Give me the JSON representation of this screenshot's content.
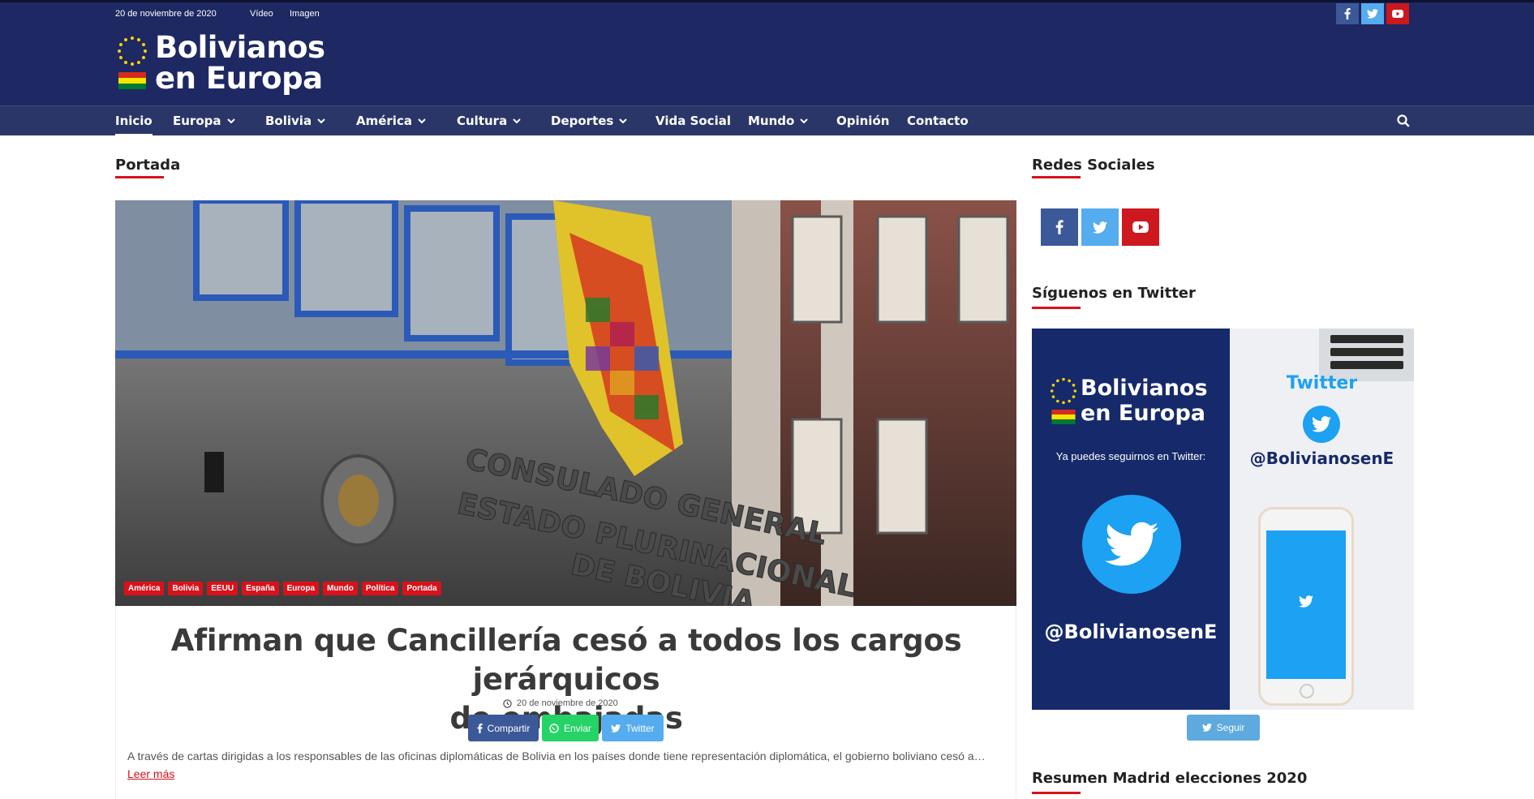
{
  "topbar": {
    "date": "20 de noviembre de 2020",
    "links": [
      "Vídeo",
      "Imagen"
    ],
    "social_icons": [
      "facebook-icon",
      "twitter-icon",
      "youtube-icon"
    ]
  },
  "brand": {
    "line1": "Bolivianos",
    "line2": "en Europa"
  },
  "nav": {
    "items": [
      {
        "label": "Inicio",
        "has_dropdown": false,
        "active": true
      },
      {
        "label": "Europa",
        "has_dropdown": true
      },
      {
        "label": "Bolivia",
        "has_dropdown": true
      },
      {
        "label": "América",
        "has_dropdown": true
      },
      {
        "label": "Cultura",
        "has_dropdown": true
      },
      {
        "label": "Deportes",
        "has_dropdown": true
      },
      {
        "label": "Vida Social",
        "has_dropdown": false
      },
      {
        "label": "Mundo",
        "has_dropdown": true
      },
      {
        "label": "Opinión",
        "has_dropdown": false
      },
      {
        "label": "Contacto",
        "has_dropdown": false
      }
    ],
    "search_icon": "search-icon"
  },
  "main": {
    "section_title": "Portada",
    "featured": {
      "image_text_line1": "CONSULADO GENERAL",
      "image_text_line2": "ESTADO PLURINACIONAL",
      "image_text_line3": "DE BOLIVIA",
      "tags": [
        "América",
        "Bolivia",
        "EEUU",
        "España",
        "Europa",
        "Mundo",
        "Política",
        "Portada"
      ],
      "headline_line1": "Afirman que Cancillería cesó a todos los cargos jerárquicos",
      "headline_line2": "de embajadas",
      "date": "20 de noviembre de 2020",
      "share": {
        "facebook": "Compartir",
        "whatsapp": "Enviar",
        "twitter": "Twitter"
      },
      "excerpt": "A través de cartas dirigidas a los responsables de las oficinas diplomáticas de Bolivia en los países donde tiene representación diplomática, el gobierno boliviano cesó a…",
      "read_more": "Leer más"
    }
  },
  "sidebar": {
    "social_title": "Redes Sociales",
    "twitter_title": "Síguenos en Twitter",
    "twitter_card": {
      "brand_line1": "Bolivianos",
      "brand_line2": "en Europa",
      "follow_text": "Ya puedes seguirnos en Twitter:",
      "handle": "@BolivianosenE",
      "right_title": "Twitter",
      "right_handle": "@BolivianosenE"
    },
    "follow_button": "Seguir",
    "madrid_title": "Resumen Madrid elecciones 2020"
  },
  "colors": {
    "header": "#1e2862",
    "nav": "#2b3668",
    "accent": "#d8121b",
    "facebook": "#3b5998",
    "twitter": "#55acee",
    "youtube": "#cc181e",
    "whatsapp": "#25d366"
  }
}
